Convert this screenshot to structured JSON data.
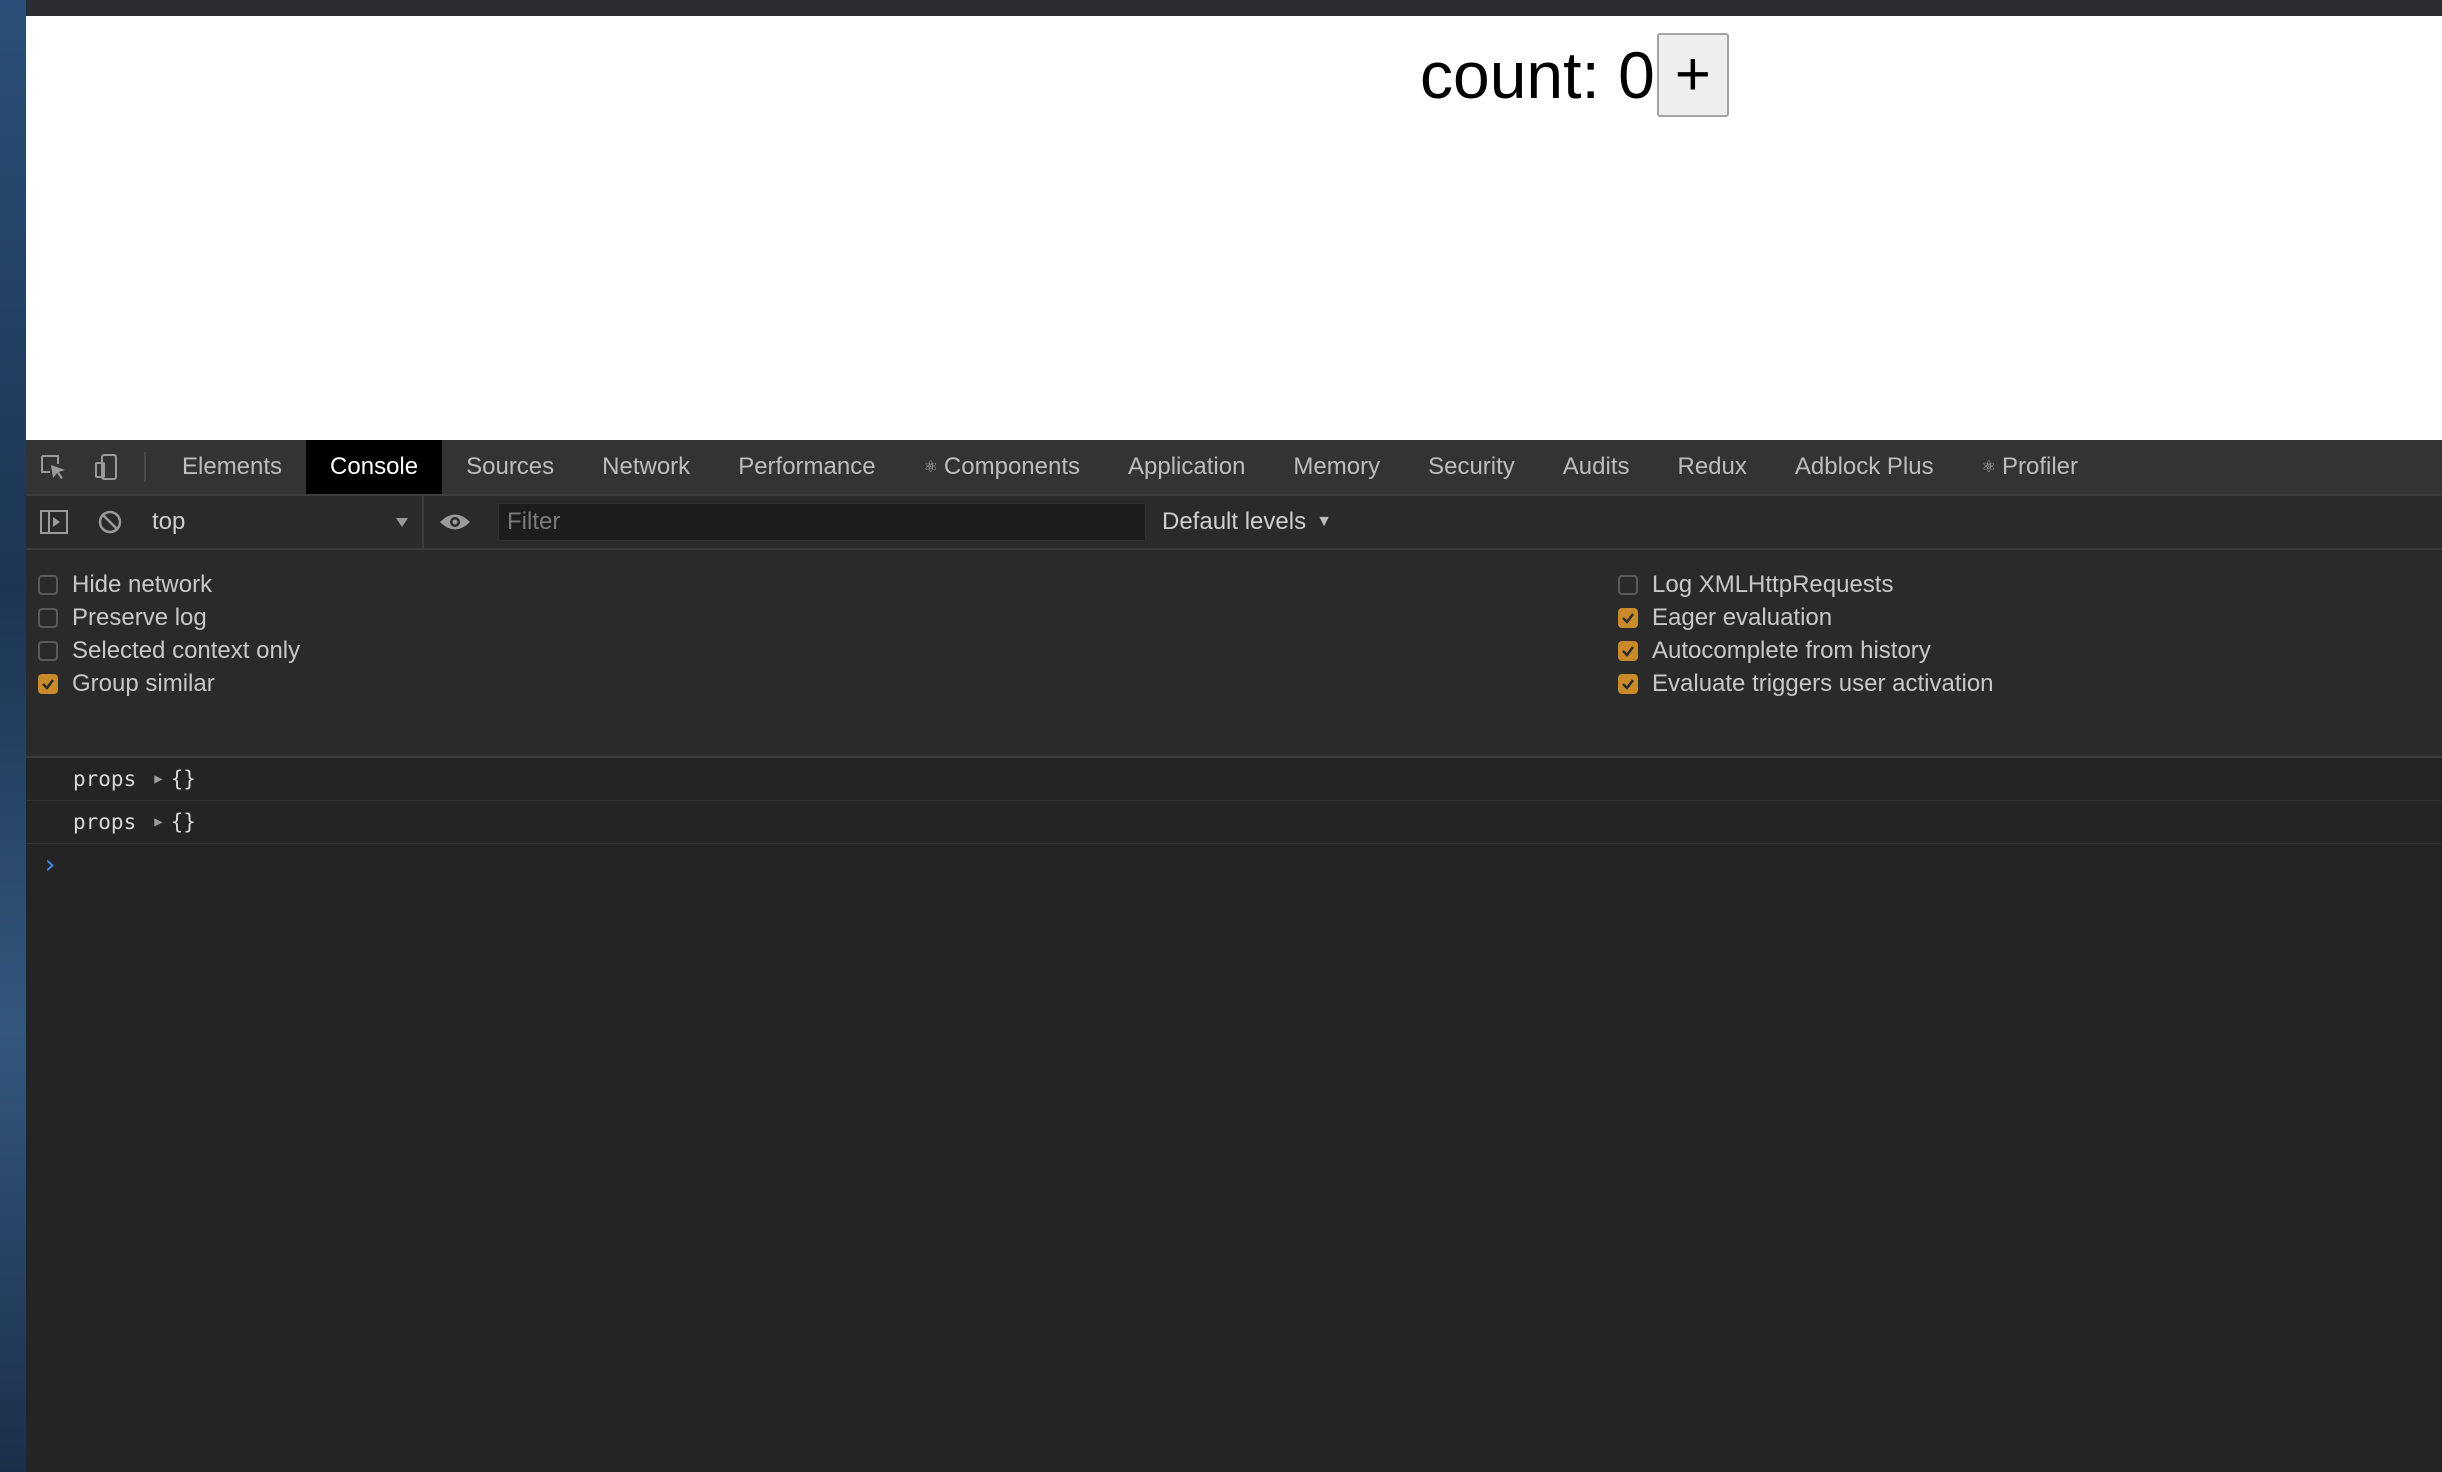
{
  "page": {
    "count_label": "count: 0",
    "increment_label": "+"
  },
  "devtools": {
    "tabs": [
      {
        "label": "Elements",
        "active": false
      },
      {
        "label": "Console",
        "active": true
      },
      {
        "label": "Sources",
        "active": false
      },
      {
        "label": "Network",
        "active": false
      },
      {
        "label": "Performance",
        "active": false
      },
      {
        "label": "Components",
        "active": false,
        "react": true
      },
      {
        "label": "Application",
        "active": false
      },
      {
        "label": "Memory",
        "active": false
      },
      {
        "label": "Security",
        "active": false
      },
      {
        "label": "Audits",
        "active": false
      },
      {
        "label": "Redux",
        "active": false
      },
      {
        "label": "Adblock Plus",
        "active": false
      },
      {
        "label": "Profiler",
        "active": false,
        "react": true
      }
    ],
    "react_glyph": "⚛",
    "toolbar": {
      "context": "top",
      "filter_placeholder": "Filter",
      "filter_value": "",
      "levels_label": "Default levels"
    },
    "settings": {
      "left": [
        {
          "label": "Hide network",
          "checked": false
        },
        {
          "label": "Preserve log",
          "checked": false
        },
        {
          "label": "Selected context only",
          "checked": false
        },
        {
          "label": "Group similar",
          "checked": true
        }
      ],
      "right": [
        {
          "label": "Log XMLHttpRequests",
          "checked": false
        },
        {
          "label": "Eager evaluation",
          "checked": true
        },
        {
          "label": "Autocomplete from history",
          "checked": true
        },
        {
          "label": "Evaluate triggers user activation",
          "checked": true
        }
      ]
    },
    "console_messages": [
      {
        "text": "props",
        "object": "{}"
      },
      {
        "text": "props",
        "object": "{}"
      }
    ],
    "prompt": "›"
  },
  "colors": {
    "checkbox_checked": "#c98a2a",
    "prompt": "#3b8eea",
    "active_tab_bg": "#000000"
  }
}
